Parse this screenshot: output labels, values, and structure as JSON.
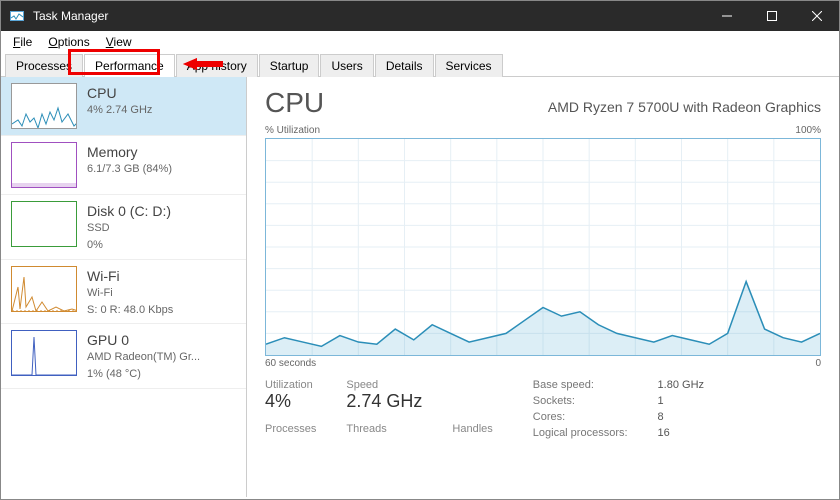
{
  "window": {
    "title": "Task Manager"
  },
  "menu": {
    "file": "File",
    "options": "Options",
    "view": "View"
  },
  "tabs": {
    "processes": "Processes",
    "performance": "Performance",
    "apphistory": "App history",
    "startup": "Startup",
    "users": "Users",
    "details": "Details",
    "services": "Services"
  },
  "sidebar": {
    "items": [
      {
        "name": "CPU",
        "sub1": "4% 2.74 GHz"
      },
      {
        "name": "Memory",
        "sub1": "6.1/7.3 GB (84%)"
      },
      {
        "name": "Disk 0 (C: D:)",
        "sub1": "SSD",
        "sub2": "0%"
      },
      {
        "name": "Wi-Fi",
        "sub1": "Wi-Fi",
        "sub2": "S: 0 R: 48.0 Kbps"
      },
      {
        "name": "GPU 0",
        "sub1": "AMD Radeon(TM) Gr...",
        "sub2": "1% (48 °C)"
      }
    ]
  },
  "main": {
    "title": "CPU",
    "subtitle": "AMD Ryzen 7 5700U with Radeon Graphics",
    "util_label": "% Utilization",
    "util_max": "100%",
    "x_left": "60 seconds",
    "x_right": "0",
    "stats": {
      "util_lbl": "Utilization",
      "util_val": "4%",
      "speed_lbl": "Speed",
      "speed_val": "2.74 GHz",
      "procs_lbl": "Processes",
      "threads_lbl": "Threads",
      "handles_lbl": "Handles"
    },
    "right": {
      "base_lbl": "Base speed:",
      "base_val": "1.80 GHz",
      "sockets_lbl": "Sockets:",
      "sockets_val": "1",
      "cores_lbl": "Cores:",
      "cores_val": "8",
      "log_lbl": "Logical processors:",
      "log_val": "16"
    }
  },
  "chart_data": {
    "type": "line",
    "title": "% Utilization",
    "xlabel": "60 seconds → 0",
    "ylabel": "% Utilization",
    "ylim": [
      0,
      100
    ],
    "x": [
      0,
      2,
      4,
      6,
      8,
      10,
      12,
      14,
      16,
      18,
      20,
      22,
      24,
      26,
      28,
      30,
      32,
      34,
      36,
      38,
      40,
      42,
      44,
      46,
      48,
      50,
      52,
      54,
      56,
      58,
      60
    ],
    "values": [
      5,
      8,
      6,
      4,
      9,
      6,
      5,
      12,
      7,
      14,
      10,
      6,
      8,
      10,
      16,
      22,
      18,
      20,
      14,
      10,
      8,
      6,
      9,
      7,
      5,
      10,
      34,
      12,
      8,
      6,
      10
    ]
  }
}
